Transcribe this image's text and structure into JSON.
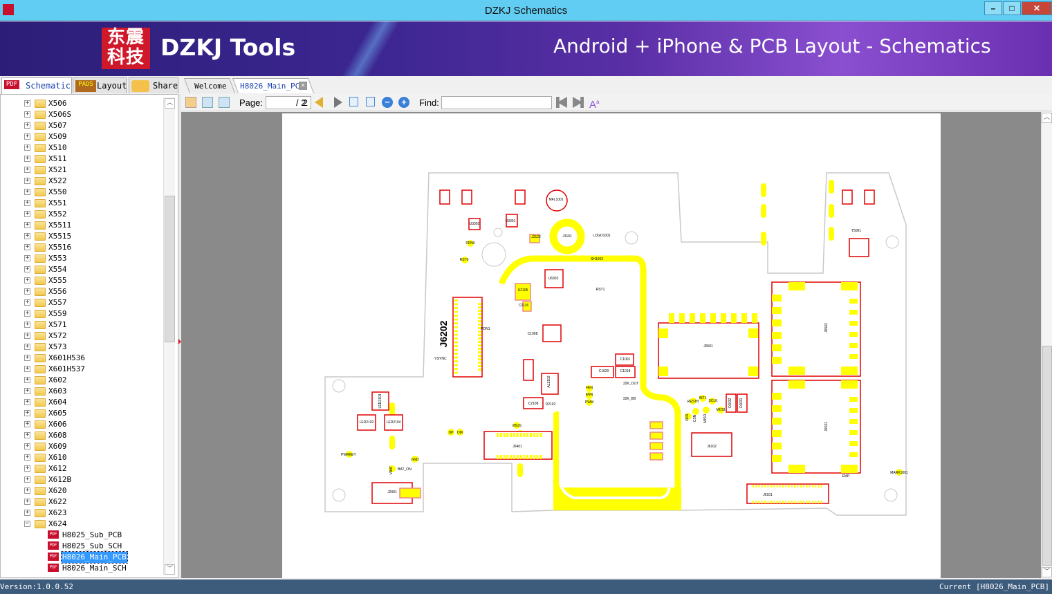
{
  "window": {
    "title": "DZKJ Schematics",
    "minimize": "–",
    "maximize": "□",
    "close": "✕"
  },
  "banner": {
    "logo_text": "东震科技",
    "brand": "DZKJ Tools",
    "slogan": "Android + iPhone & PCB Layout - Schematics"
  },
  "left_tabs": [
    {
      "label": "Schematic",
      "icon": "pdf-icon",
      "badge": "PDF",
      "active": true
    },
    {
      "label": "Layout",
      "icon": "pads-icon",
      "badge": "PADS"
    },
    {
      "label": "Share",
      "icon": "cloud-share-icon"
    }
  ],
  "doc_tabs": [
    {
      "label": "Welcome"
    },
    {
      "label": "H8026_Main_PCB",
      "active": true
    }
  ],
  "tree": {
    "folders": [
      "X506",
      "X506S",
      "X507",
      "X509",
      "X510",
      "X511",
      "X521",
      "X522",
      "X550",
      "X551",
      "X552",
      "X5511",
      "X5515",
      "X5516",
      "X553",
      "X554",
      "X555",
      "X556",
      "X557",
      "X559",
      "X571",
      "X572",
      "X573",
      "X601H536",
      "X601H537",
      "X602",
      "X603",
      "X604",
      "X605",
      "X606",
      "X608",
      "X609",
      "X610",
      "X612",
      "X612B",
      "X620",
      "X622",
      "X623",
      "X624"
    ],
    "expanded": "X624",
    "files": [
      "H8025_Sub_PCB",
      "H8025_Sub_SCH",
      "H8026_Main_PCB",
      "H8026_Main_SCH"
    ],
    "selected": "H8026_Main_PCB"
  },
  "toolbar": {
    "page_label": "Page:",
    "page_value": "2",
    "page_total": "/ 2",
    "find_label": "Find:",
    "find_value": ""
  },
  "pcb": {
    "colors": {
      "pad": "#ffff00",
      "outline": "#e00000",
      "board": "#c8c8c8"
    },
    "labels": [
      "J6202",
      "PDN1",
      "VSYNC",
      "J3101",
      "LOGO1001",
      "SH1003",
      "MFL1001",
      "U3302",
      "U3301",
      "J3122",
      "PDN0",
      "RST0",
      "U6302",
      "U2105",
      "C2116",
      "C1008",
      "C1001",
      "C1020",
      "C1018",
      "J6501",
      "J6502",
      "J6531",
      "J6101",
      "J6401",
      "J6102",
      "J2001",
      "LED2103",
      "LED2102",
      "LED2104",
      "VBUS",
      "DP",
      "DM",
      "PWRKEY",
      "VBAT",
      "BAT_ON",
      "GND",
      "FEN",
      "ENN",
      "PWM",
      "32K_OUT",
      "32K_BB",
      "RESTB",
      "INT1",
      "SCLK",
      "CSN",
      "MISO",
      "MOSI",
      "VDD",
      "C6032",
      "C6031",
      "EMP",
      "MARK1001",
      "T5001",
      "RST1",
      "C2108",
      "AL2102",
      "D2102"
    ]
  },
  "status": {
    "version": "Version:1.0.0.52",
    "current": "Current [H8026_Main_PCB]"
  }
}
